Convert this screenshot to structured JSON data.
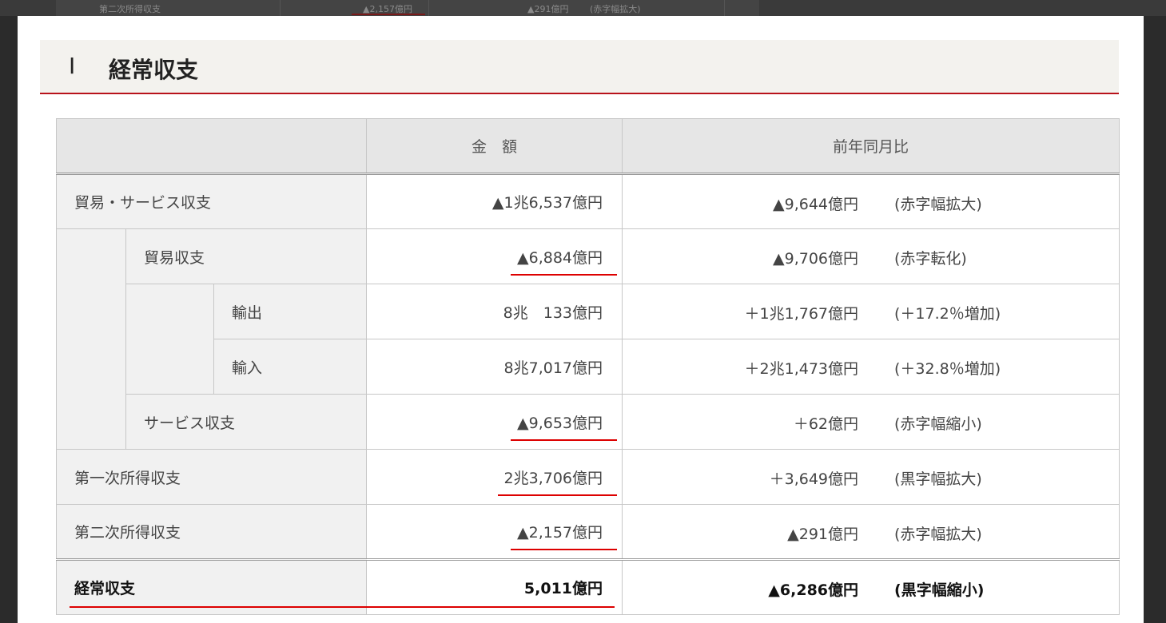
{
  "background_row": {
    "label": "第二次所得収支",
    "amount": "▲2,157億円",
    "change": "▲291億円",
    "note": "(赤字幅拡大)"
  },
  "section": {
    "number": "Ⅰ",
    "title": "経常収支"
  },
  "table": {
    "headers": {
      "label": "",
      "amount": "金　額",
      "compare": "前年同月比"
    },
    "rows": {
      "trade_services": {
        "label": "貿易・サービス収支",
        "amount": "▲1兆6,537億円",
        "change": "▲9,644億円",
        "note": "(赤字幅拡大)"
      },
      "trade": {
        "label": "貿易収支",
        "amount": "▲6,884億円",
        "change": "▲9,706億円",
        "note": "(赤字転化)"
      },
      "exports": {
        "label": "輸出",
        "amount": "8兆　133億円",
        "change": "＋1兆1,767億円",
        "note": "(＋17.2％増加)"
      },
      "imports": {
        "label": "輸入",
        "amount": "8兆7,017億円",
        "change": "＋2兆1,473億円",
        "note": "(＋32.8％増加)"
      },
      "services": {
        "label": "サービス収支",
        "amount": "▲9,653億円",
        "change": "＋62億円",
        "note": "(赤字幅縮小)"
      },
      "primary_income": {
        "label": "第一次所得収支",
        "amount": "2兆3,706億円",
        "change": "＋3,649億円",
        "note": "(黒字幅拡大)"
      },
      "secondary_income": {
        "label": "第二次所得収支",
        "amount": "▲2,157億円",
        "change": "▲291億円",
        "note": "(赤字幅拡大)"
      },
      "current_account": {
        "label": "経常収支",
        "amount": "5,011億円",
        "change": "▲6,286億円",
        "note": "(黒字幅縮小)"
      }
    }
  },
  "colors": {
    "accent_red": "#d00000",
    "heading_rule": "#b8121b",
    "label_bg": "#f1f1f1",
    "header_bg": "#e6e6e6"
  }
}
